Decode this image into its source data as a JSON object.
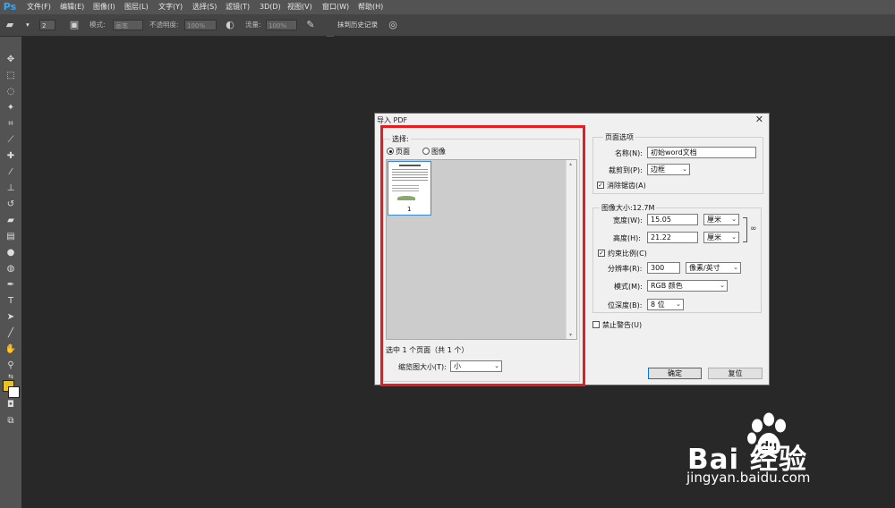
{
  "app": {
    "logo": "Ps"
  },
  "menu": [
    "文件(F)",
    "编辑(E)",
    "图像(I)",
    "图层(L)",
    "文字(Y)",
    "选择(S)",
    "滤镜(T)",
    "3D(D)",
    "视图(V)",
    "窗口(W)",
    "帮助(H)"
  ],
  "options": {
    "brush_size": "2",
    "mode_label": "模式:",
    "mode_value": "画笔",
    "opacity_label": "不透明度:",
    "opacity_value": "100%",
    "flow_label": "流量:",
    "flow_value": "100%",
    "history_label": "抹到历史记录"
  },
  "colors": {
    "foreground": "#e8c22b",
    "background": "#ffffff",
    "highlight": "#e81b23"
  },
  "dialog": {
    "title": "导入 PDF",
    "select_legend": "选择:",
    "radio_page": "页面",
    "radio_image": "图像",
    "thumbnail_page": "1",
    "selection_status": "选中 1 个页面（共 1 个）",
    "thumb_size_label": "缩览图大小(T):",
    "thumb_size_value": "小",
    "page_options_legend": "页面选项",
    "name_label": "名称(N):",
    "name_value": "初始word文档",
    "crop_label": "裁剪到(P):",
    "crop_value": "边框",
    "antialias_label": "消除锯齿(A)",
    "image_size_legend": "图像大小:12.7M",
    "width_label": "宽度(W):",
    "width_value": "15.05",
    "width_unit": "厘米",
    "height_label": "高度(H):",
    "height_value": "21.22",
    "height_unit": "厘米",
    "constrain_label": "约束比例(C)",
    "resolution_label": "分辨率(R):",
    "resolution_value": "300",
    "resolution_unit": "像素/英寸",
    "mode_label": "模式(M):",
    "mode_value": "RGB 颜色",
    "depth_label": "位深度(B):",
    "depth_value": "8 位",
    "suppress_label": "禁止警告(U)",
    "ok_label": "确定",
    "reset_label": "复位"
  },
  "watermark": {
    "brand": "Bai  经验",
    "url": "jingyan.baidu.com"
  }
}
